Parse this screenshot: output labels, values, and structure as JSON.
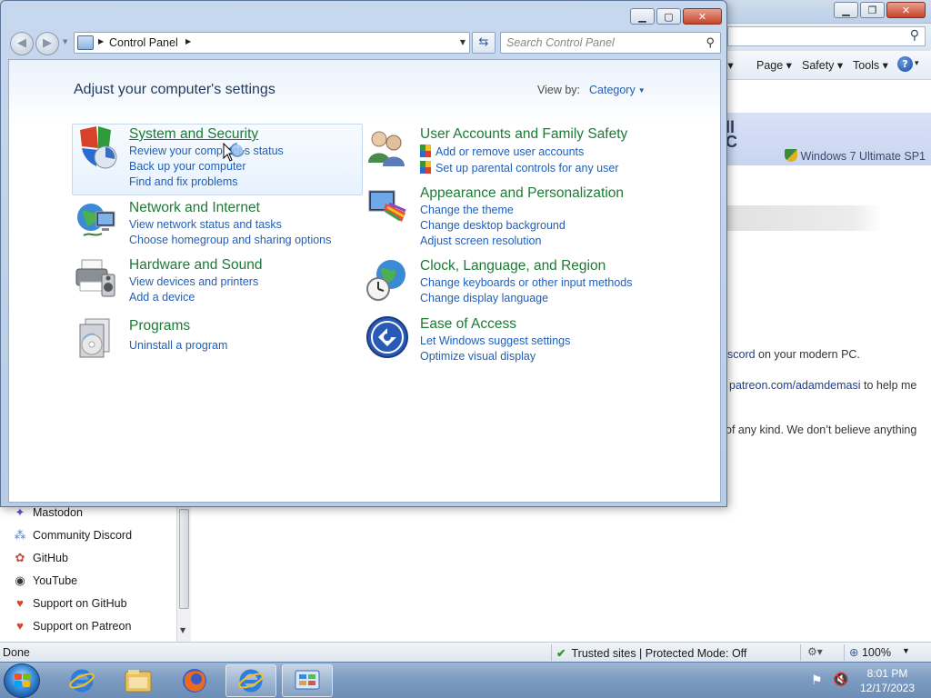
{
  "ie": {
    "commands": [
      "Page",
      "Safety",
      "Tools"
    ],
    "banner_text": "ll\nC",
    "banner_os": "Windows 7 Ultimate SP1",
    "body_lines": [
      {
        "link": "scord",
        "text": " on your modern PC."
      },
      {
        "link": "patreon.com/adamdemasi",
        "text": " to help me"
      },
      {
        "link": "",
        "text": "of any kind. We don’t believe anything"
      }
    ],
    "sidebar_items": [
      {
        "label": "Mastodon",
        "icon": "mastodon-icon"
      },
      {
        "label": "Community Discord",
        "icon": "discord-icon"
      },
      {
        "label": "GitHub",
        "icon": "github-icon"
      },
      {
        "label": "YouTube",
        "icon": "youtube-icon"
      },
      {
        "label": "Support on GitHub",
        "icon": "heart-icon"
      },
      {
        "label": "Support on Patreon",
        "icon": "heart-icon"
      }
    ],
    "status": {
      "done": "Done",
      "zone": "Trusted sites | Protected Mode: Off",
      "zoom": "100%"
    }
  },
  "cp": {
    "address": "Control Panel",
    "search_placeholder": "Search Control Panel",
    "heading": "Adjust your computer's settings",
    "view_by_label": "View by:",
    "view_by_value": "Category",
    "categories": [
      {
        "title": "System and Security",
        "links": [
          "Review your computer's status",
          "Back up your computer",
          "Find and fix problems"
        ]
      },
      {
        "title": "Network and Internet",
        "links": [
          "View network status and tasks",
          "Choose homegroup and sharing options"
        ]
      },
      {
        "title": "Hardware and Sound",
        "links": [
          "View devices and printers",
          "Add a device"
        ]
      },
      {
        "title": "Programs",
        "links": [
          "Uninstall a program"
        ]
      },
      {
        "title": "User Accounts and Family Safety",
        "links": [
          "Add or remove user accounts",
          "Set up parental controls for any user"
        ]
      },
      {
        "title": "Appearance and Personalization",
        "links": [
          "Change the theme",
          "Change desktop background",
          "Adjust screen resolution"
        ]
      },
      {
        "title": "Clock, Language, and Region",
        "links": [
          "Change keyboards or other input methods",
          "Change display language"
        ]
      },
      {
        "title": "Ease of Access",
        "links": [
          "Let Windows suggest settings",
          "Optimize visual display"
        ]
      }
    ]
  },
  "taskbar": {
    "time": "8:01 PM",
    "date": "12/17/2023",
    "pinned": [
      "internet-explorer-icon",
      "windows-explorer-icon",
      "firefox-icon",
      "internet-explorer-icon",
      "control-panel-icon"
    ]
  },
  "colors": {
    "category_title": "#1c7a35",
    "link": "#1f5fb8",
    "heading": "#1e3a5f"
  }
}
